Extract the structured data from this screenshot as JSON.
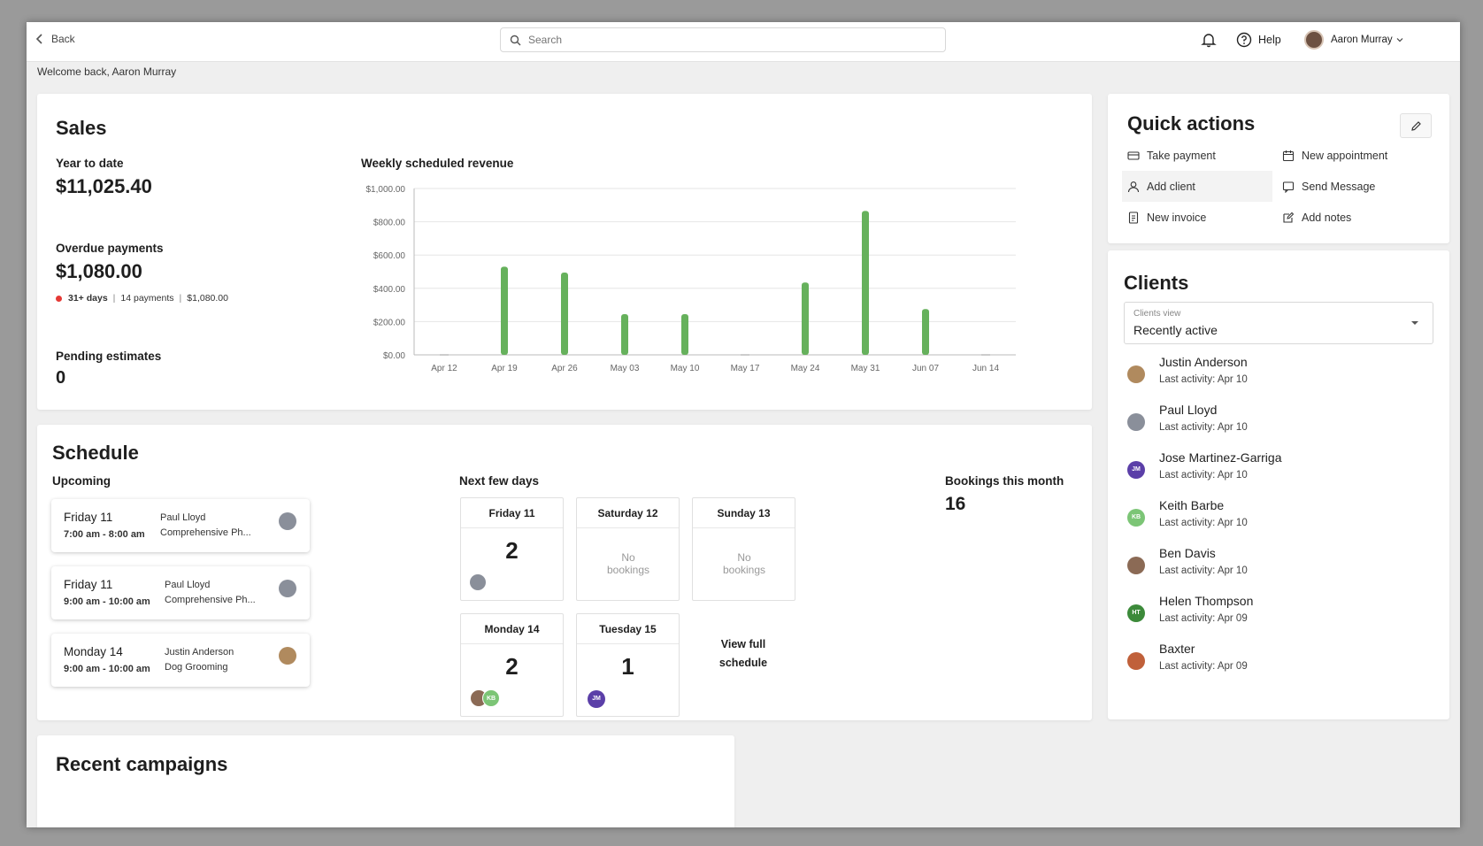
{
  "topbar": {
    "back_label": "Back",
    "search_placeholder": "Search",
    "help_label": "Help",
    "user_name": "Aaron Murray"
  },
  "welcome": "Welcome back, Aaron Murray",
  "sales": {
    "title": "Sales",
    "ytd_label": "Year to date",
    "ytd_value": "$11,025.40",
    "overdue_label": "Overdue payments",
    "overdue_value": "$1,080.00",
    "overdue_days": "31+ days",
    "overdue_payments": "14 payments",
    "overdue_amount": "$1,080.00",
    "overdue_sep": "|",
    "pending_label": "Pending estimates",
    "pending_value": "0",
    "status_color": "#e53935"
  },
  "chart_data": {
    "type": "bar",
    "title": "Weekly scheduled revenue",
    "categories": [
      "Apr 12",
      "Apr 19",
      "Apr 26",
      "May 03",
      "May 10",
      "May 17",
      "May 24",
      "May 31",
      "Jun 07",
      "Jun 14"
    ],
    "values": [
      0,
      530,
      495,
      245,
      245,
      0,
      435,
      865,
      275,
      0
    ],
    "yticks": [
      "$0.00",
      "$200.00",
      "$400.00",
      "$600.00",
      "$800.00",
      "$1,000.00"
    ],
    "ylim": [
      0,
      1000
    ],
    "grid": true,
    "bar_color": "#66b15c"
  },
  "quick_actions": {
    "title": "Quick actions",
    "items": [
      {
        "label": "Take payment",
        "icon": "card-icon"
      },
      {
        "label": "New appointment",
        "icon": "calendar-icon"
      },
      {
        "label": "Add client",
        "icon": "person-icon"
      },
      {
        "label": "Send Message",
        "icon": "message-icon"
      },
      {
        "label": "New invoice",
        "icon": "invoice-icon"
      },
      {
        "label": "Add notes",
        "icon": "notes-icon"
      }
    ]
  },
  "clients": {
    "title": "Clients",
    "view_label": "Clients view",
    "view_value": "Recently active",
    "list": [
      {
        "name": "Justin Anderson",
        "activity": "Last activity: Apr 10",
        "initials": "",
        "color": "#b08a5e"
      },
      {
        "name": "Paul Lloyd",
        "activity": "Last activity: Apr 10",
        "initials": "",
        "color": "#8a8f9a"
      },
      {
        "name": "Jose Martinez-Garriga",
        "activity": "Last activity: Apr 10",
        "initials": "JM",
        "color": "#5b3fa8"
      },
      {
        "name": "Keith Barbe",
        "activity": "Last activity: Apr 10",
        "initials": "KB",
        "color": "#7cc576"
      },
      {
        "name": "Ben Davis",
        "activity": "Last activity: Apr 10",
        "initials": "",
        "color": "#8b6a55"
      },
      {
        "name": "Helen Thompson",
        "activity": "Last activity: Apr 09",
        "initials": "HT",
        "color": "#3c8a3a"
      },
      {
        "name": "Baxter",
        "activity": "Last activity: Apr 09",
        "initials": "",
        "color": "#c0603a"
      }
    ]
  },
  "schedule": {
    "title": "Schedule",
    "upcoming_label": "Upcoming",
    "appointments": [
      {
        "day": "Friday 11",
        "time": "7:00 am - 8:00 am",
        "client": "Paul Lloyd",
        "service": "Comprehensive Ph..."
      },
      {
        "day": "Friday 11",
        "time": "9:00 am - 10:00 am",
        "client": "Paul Lloyd",
        "service": "Comprehensive Ph..."
      },
      {
        "day": "Monday 14",
        "time": "9:00 am - 10:00 am",
        "client": "Justin Anderson",
        "service": "Dog Grooming"
      }
    ],
    "next_days_label": "Next few days",
    "days": [
      {
        "label": "Friday 11",
        "count": "2"
      },
      {
        "label": "Saturday 12",
        "empty": "No bookings"
      },
      {
        "label": "Sunday 13",
        "empty": "No bookings"
      },
      {
        "label": "Monday 14",
        "count": "2"
      },
      {
        "label": "Tuesday 15",
        "count": "1"
      }
    ],
    "view_full": "View full schedule",
    "bookings_label": "Bookings this month",
    "bookings_value": "16",
    "avatar_kb": "KB",
    "avatar_jm": "JM"
  },
  "campaigns": {
    "title": "Recent campaigns"
  }
}
